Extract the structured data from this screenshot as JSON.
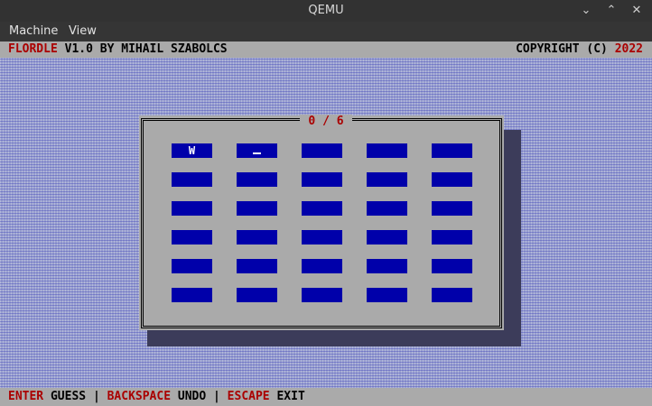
{
  "window": {
    "title": "QEMU"
  },
  "menu": {
    "items": [
      "Machine",
      "View"
    ]
  },
  "header": {
    "app_name": "FLORDLE",
    "app_rest": " V1.0 BY MIHAIL SZABOLCS",
    "copyright_text": "COPYRIGHT (C) ",
    "copyright_year": "2022"
  },
  "dialog": {
    "counter": "0 / 6"
  },
  "board": {
    "rows": [
      [
        "W",
        "_",
        "",
        "",
        ""
      ],
      [
        "",
        "",
        "",
        "",
        ""
      ],
      [
        "",
        "",
        "",
        "",
        ""
      ],
      [
        "",
        "",
        "",
        "",
        ""
      ],
      [
        "",
        "",
        "",
        "",
        ""
      ],
      [
        "",
        "",
        "",
        "",
        ""
      ]
    ]
  },
  "footer": {
    "enter_key": "ENTER",
    "enter_action": " GUESS ",
    "sep": "|",
    "backspace_key": " BACKSPACE",
    "backspace_action": " UNDO ",
    "escape_key": " ESCAPE",
    "escape_action": " EXIT"
  },
  "colors": {
    "accent": "#aa0000",
    "cell": "#0000aa",
    "panel": "#aaaaaa"
  }
}
